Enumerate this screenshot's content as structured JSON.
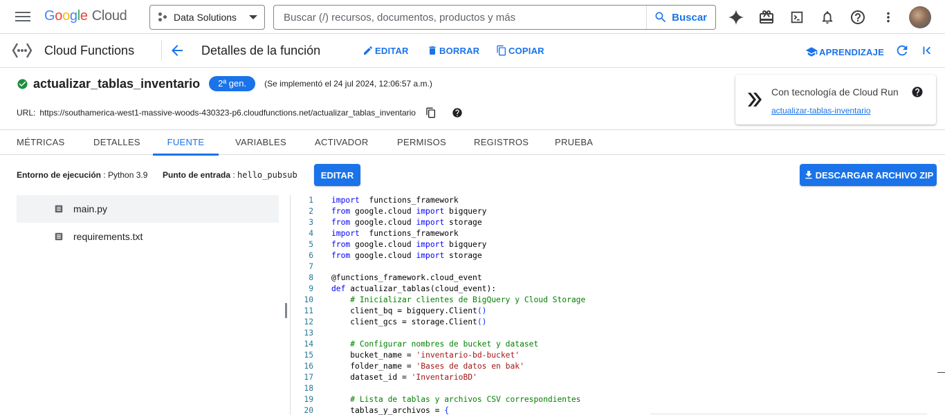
{
  "topbar": {
    "logo_parts": [
      "G",
      "o",
      "o",
      "g",
      "l",
      "e"
    ],
    "logo_cloud": "Cloud",
    "project": "Data Solutions",
    "search_placeholder": "Buscar (/) recursos, documentos, productos y más",
    "search_button": "Buscar",
    "icons": [
      "gemini-icon",
      "gift-icon",
      "cloud-shell-icon",
      "notifications-icon",
      "help-icon",
      "more-vert-icon"
    ]
  },
  "secbar": {
    "product": "Cloud Functions",
    "title": "Detalles de la función",
    "actions": {
      "edit": "EDITAR",
      "delete": "BORRAR",
      "copy": "COPIAR"
    },
    "learning": "APRENDIZAJE"
  },
  "function": {
    "name": "actualizar_tablas_inventario",
    "generation": "2ª gen.",
    "deployed": "(Se implementó el 24 jul 2024, 12:06:57 a.m.)",
    "url_label": "URL:",
    "url": "https://southamerica-west1-massive-woods-430323-p6.cloudfunctions.net/actualizar_tablas_inventario"
  },
  "cloudrun": {
    "title": "Con tecnología de Cloud Run",
    "link": "actualizar-tablas-inventario"
  },
  "tabs": [
    "MÉTRICAS",
    "DETALLES",
    "FUENTE",
    "VARIABLES",
    "ACTIVADOR",
    "PERMISOS",
    "REGISTROS",
    "PRUEBA"
  ],
  "active_tab": "FUENTE",
  "source": {
    "runtime_label": "Entorno de ejecución",
    "runtime_value": "Python 3.9",
    "entry_label": "Punto de entrada",
    "entry_value": "hello_pubsub",
    "edit_button": "EDITAR",
    "download_button": "DESCARGAR ARCHIVO ZIP"
  },
  "files": [
    {
      "name": "main.py",
      "selected": true
    },
    {
      "name": "requirements.txt",
      "selected": false
    }
  ],
  "code": [
    {
      "n": "1",
      "t": [
        [
          "kw",
          "import"
        ],
        [
          "",
          "  functions_framework"
        ]
      ]
    },
    {
      "n": "2",
      "t": [
        [
          "kw",
          "from"
        ],
        [
          "",
          " google.cloud "
        ],
        [
          "kw",
          "import"
        ],
        [
          "",
          " bigquery"
        ]
      ]
    },
    {
      "n": "3",
      "t": [
        [
          "kw",
          "from"
        ],
        [
          "",
          " google.cloud "
        ],
        [
          "kw",
          "import"
        ],
        [
          "",
          " storage"
        ]
      ]
    },
    {
      "n": "4",
      "t": [
        [
          "kw",
          "import"
        ],
        [
          "",
          "  functions_framework"
        ]
      ]
    },
    {
      "n": "5",
      "t": [
        [
          "kw",
          "from"
        ],
        [
          "",
          " google.cloud "
        ],
        [
          "kw",
          "import"
        ],
        [
          "",
          " bigquery"
        ]
      ]
    },
    {
      "n": "6",
      "t": [
        [
          "kw",
          "from"
        ],
        [
          "",
          " google.cloud "
        ],
        [
          "kw",
          "import"
        ],
        [
          "",
          " storage"
        ]
      ]
    },
    {
      "n": "7",
      "t": []
    },
    {
      "n": "8",
      "t": [
        [
          "",
          "@functions_framework.cloud_event"
        ]
      ]
    },
    {
      "n": "9",
      "t": [
        [
          "kw",
          "def"
        ],
        [
          "",
          " actualizar_tablas(cloud_event):"
        ]
      ]
    },
    {
      "n": "10",
      "t": [
        [
          "",
          "    "
        ],
        [
          "com",
          "# Inicializar clientes de BigQuery y Cloud Storage"
        ]
      ]
    },
    {
      "n": "11",
      "t": [
        [
          "",
          "    client_bq = bigquery.Client"
        ],
        [
          "paren",
          "()"
        ]
      ]
    },
    {
      "n": "12",
      "t": [
        [
          "",
          "    client_gcs = storage.Client"
        ],
        [
          "paren",
          "()"
        ]
      ]
    },
    {
      "n": "13",
      "t": []
    },
    {
      "n": "14",
      "t": [
        [
          "",
          "    "
        ],
        [
          "com",
          "# Configurar nombres de bucket y dataset"
        ]
      ]
    },
    {
      "n": "15",
      "t": [
        [
          "",
          "    bucket_name = "
        ],
        [
          "str",
          "'inventario-bd-bucket'"
        ]
      ]
    },
    {
      "n": "16",
      "t": [
        [
          "",
          "    folder_name = "
        ],
        [
          "str",
          "'Bases de datos en bak'"
        ]
      ]
    },
    {
      "n": "17",
      "t": [
        [
          "",
          "    dataset_id = "
        ],
        [
          "str",
          "'InventarioBD'"
        ]
      ]
    },
    {
      "n": "18",
      "t": []
    },
    {
      "n": "19",
      "t": [
        [
          "",
          "    "
        ],
        [
          "com",
          "# Lista de tablas y archivos CSV correspondientes"
        ]
      ]
    },
    {
      "n": "20",
      "t": [
        [
          "",
          "    tablas_y_archivos = "
        ],
        [
          "paren",
          "{"
        ]
      ]
    }
  ],
  "colors": {
    "accent": "#1a73e8",
    "success": "#1e8e3e",
    "keyword": "#0000ff",
    "string": "#a31515",
    "comment": "#008000"
  }
}
